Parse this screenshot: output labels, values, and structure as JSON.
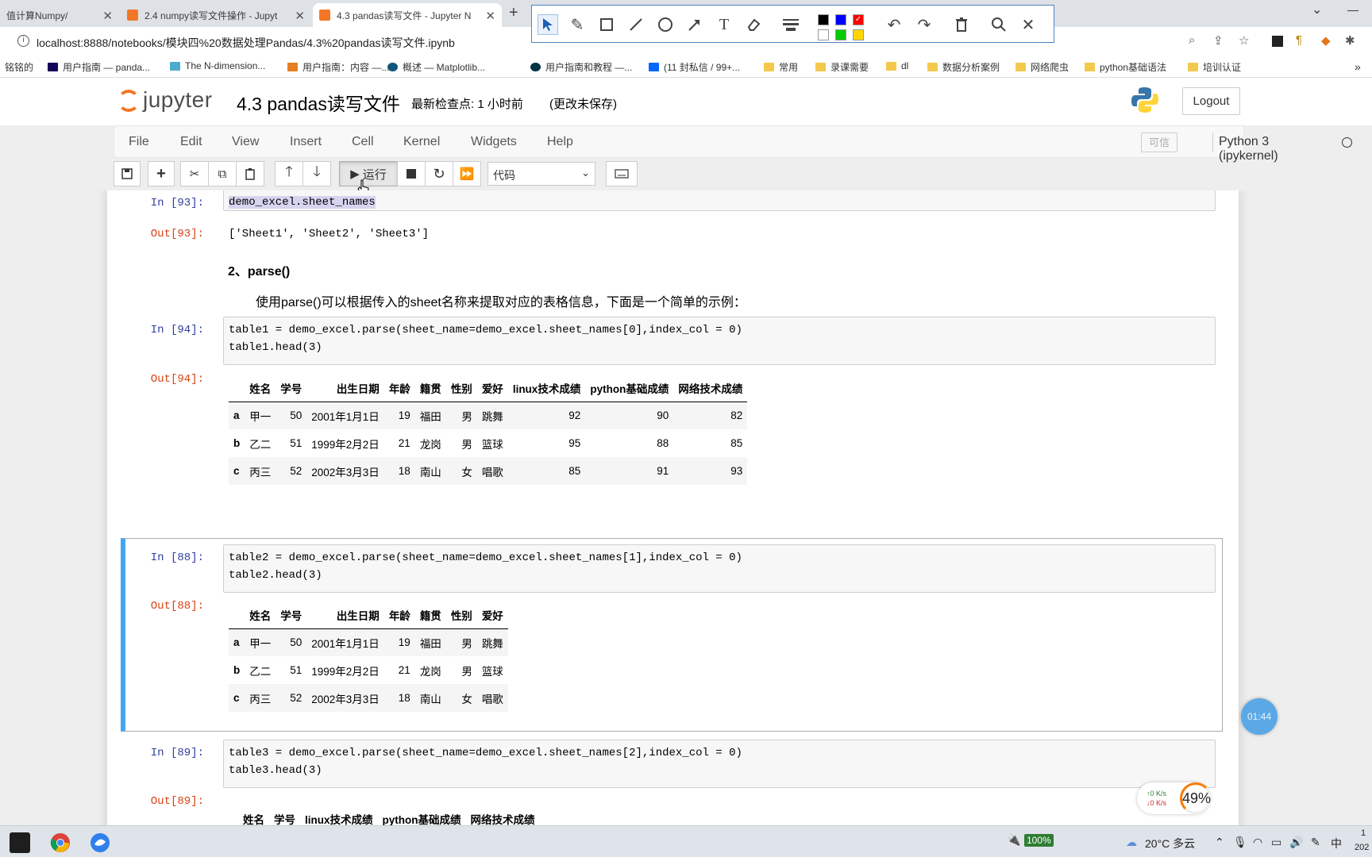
{
  "browser": {
    "tabs": [
      {
        "title": "值计算Numpy/",
        "active": false
      },
      {
        "title": "2.4 numpy读写文件操作 - Jupyt",
        "active": false
      },
      {
        "title": "4.3 pandas读写文件 - Jupyter N",
        "active": true
      }
    ],
    "url": "localhost:8888/notebooks/模块四%20数据处理Pandas/4.3%20pandas读写文件.ipynb",
    "bookmarks": [
      "铭铭的",
      "用户指南 — panda...",
      "The N-dimension...",
      "用户指南：内容 —...",
      "概述 — Matplotlib...",
      "用户指南和教程 —...",
      "(11 封私信 / 99+...",
      "常用",
      "录课需要",
      "dl",
      "数据分析案例",
      "网络爬虫",
      "python基础语法",
      "培训认证"
    ]
  },
  "annotation_toolbar": {
    "tools": [
      "select-icon",
      "pen-icon",
      "rectangle-icon",
      "line-icon",
      "circle-icon",
      "arrow-icon",
      "text-icon",
      "eraser-icon",
      "stroke-width-icon",
      "undo-icon",
      "redo-icon",
      "trash-icon",
      "zoom-icon",
      "close-icon"
    ],
    "text_tool_label": "T",
    "colors": [
      "#000000",
      "#0000ff",
      "#ff0000",
      "#ffffff",
      "#00cc00",
      "#ffd700"
    ]
  },
  "jupyter": {
    "logo": "jupyter",
    "notebook_title": "4.3 pandas读写文件",
    "checkpoint": "最新检查点: 1 小时前",
    "unsaved": "(更改未保存)",
    "logout": "Logout",
    "menu": [
      "File",
      "Edit",
      "View",
      "Insert",
      "Cell",
      "Kernel",
      "Widgets",
      "Help"
    ],
    "trusted": "可信",
    "kernel": "Python 3 (ipykernel)",
    "run_label": "运行",
    "cell_type": "代码"
  },
  "cells": {
    "c93": {
      "in_prompt": "In  [93]:",
      "code": "demo_excel.sheet_names",
      "out_prompt": "Out[93]:",
      "output": "['Sheet1', 'Sheet2', 'Sheet3']"
    },
    "md": {
      "heading": "2、parse()",
      "text": "使用parse()可以根据传入的sheet名称来提取对应的表格信息，下面是一个简单的示例："
    },
    "c94": {
      "in_prompt": "In  [94]:",
      "code_line1": "table1 = demo_excel.parse(sheet_name=demo_excel.sheet_names[0],index_col = 0)",
      "code_line2": "table1.head(3)",
      "out_prompt": "Out[94]:",
      "columns": [
        "姓名",
        "学号",
        "出生日期",
        "年龄",
        "籍贯",
        "性别",
        "爱好",
        "linux技术成绩",
        "python基础成绩",
        "网络技术成绩"
      ],
      "rows": [
        {
          "index": "a",
          "values": [
            "甲一",
            "50",
            "2001年1月1日",
            "19",
            "福田",
            "男",
            "跳舞",
            "92",
            "90",
            "82"
          ]
        },
        {
          "index": "b",
          "values": [
            "乙二",
            "51",
            "1999年2月2日",
            "21",
            "龙岗",
            "男",
            "篮球",
            "95",
            "88",
            "85"
          ]
        },
        {
          "index": "c",
          "values": [
            "丙三",
            "52",
            "2002年3月3日",
            "18",
            "南山",
            "女",
            "唱歌",
            "85",
            "91",
            "93"
          ]
        }
      ]
    },
    "c88": {
      "in_prompt": "In  [88]:",
      "code_line1": "table2 = demo_excel.parse(sheet_name=demo_excel.sheet_names[1],index_col = 0)",
      "code_line2": "table2.head(3)",
      "out_prompt": "Out[88]:",
      "columns": [
        "姓名",
        "学号",
        "出生日期",
        "年龄",
        "籍贯",
        "性别",
        "爱好"
      ],
      "rows": [
        {
          "index": "a",
          "values": [
            "甲一",
            "50",
            "2001年1月1日",
            "19",
            "福田",
            "男",
            "跳舞"
          ]
        },
        {
          "index": "b",
          "values": [
            "乙二",
            "51",
            "1999年2月2日",
            "21",
            "龙岗",
            "男",
            "篮球"
          ]
        },
        {
          "index": "c",
          "values": [
            "丙三",
            "52",
            "2002年3月3日",
            "18",
            "南山",
            "女",
            "唱歌"
          ]
        }
      ]
    },
    "c89": {
      "in_prompt": "In  [89]:",
      "code_line1": "table3 = demo_excel.parse(sheet_name=demo_excel.sheet_names[2],index_col = 0)",
      "code_line2": "table3.head(3)",
      "out_prompt": "Out[89]:",
      "columns": [
        "姓名",
        "学号",
        "linux技术成绩",
        "python基础成绩",
        "网络技术成绩"
      ]
    }
  },
  "overlays": {
    "timer": "01:44",
    "net_up": "↑0  K/s",
    "net_down": "↓0  K/s",
    "cpu": "49%"
  },
  "taskbar": {
    "battery": "100%",
    "weather": "20°C  多云",
    "ime": "中",
    "clock_partial": "1",
    "date_partial": "202"
  }
}
